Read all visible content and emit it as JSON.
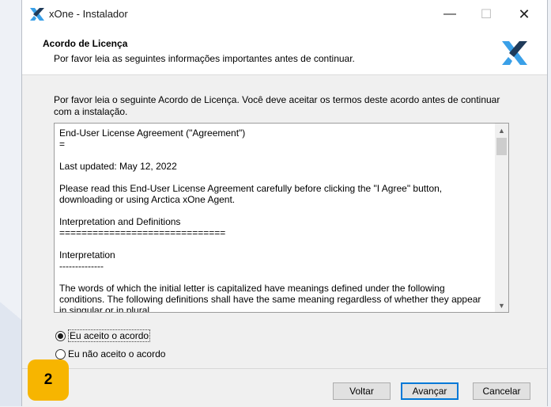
{
  "window": {
    "title": "xOne - Instalador",
    "minimize_glyph": "—",
    "maximize_glyph": "☐",
    "close_glyph": "✕"
  },
  "header": {
    "title": "Acordo de Licença",
    "subtitle": "Por favor leia as seguintes informações importantes antes de continuar."
  },
  "content": {
    "intro": "Por favor leia o seguinte Acordo de Licença. Você deve aceitar os termos deste acordo antes de continuar com a instalação.",
    "license_lines": [
      "End-User License Agreement (\"Agreement\")",
      "=",
      "",
      "Last updated: May 12, 2022",
      "",
      "Please read this End-User License Agreement carefully before clicking the \"I Agree\" button, downloading or using Arctica xOne Agent.",
      "",
      "Interpretation and Definitions",
      "==============================",
      "",
      "Interpretation",
      "--------------",
      "",
      "The words of which the initial letter is capitalized have meanings defined under the following conditions. The following definitions shall have the same meaning regardless of whether they appear in singular or in plural."
    ]
  },
  "options": {
    "accept": {
      "label": "Eu aceito o acordo",
      "checked": true
    },
    "decline": {
      "label": "Eu não aceito o acordo",
      "checked": false
    }
  },
  "buttons": {
    "back": "Voltar",
    "next": "Avançar",
    "cancel": "Cancelar"
  },
  "badge": {
    "label": "2"
  },
  "colors": {
    "accent": "#0078d7",
    "badge": "#f7b500",
    "logo_light": "#3aa0e8",
    "logo_dark": "#1f3b5a"
  },
  "icons": {
    "app_logo": "xone-logo-icon",
    "scroll_up": "chevron-up-icon",
    "scroll_down": "chevron-down-icon"
  }
}
